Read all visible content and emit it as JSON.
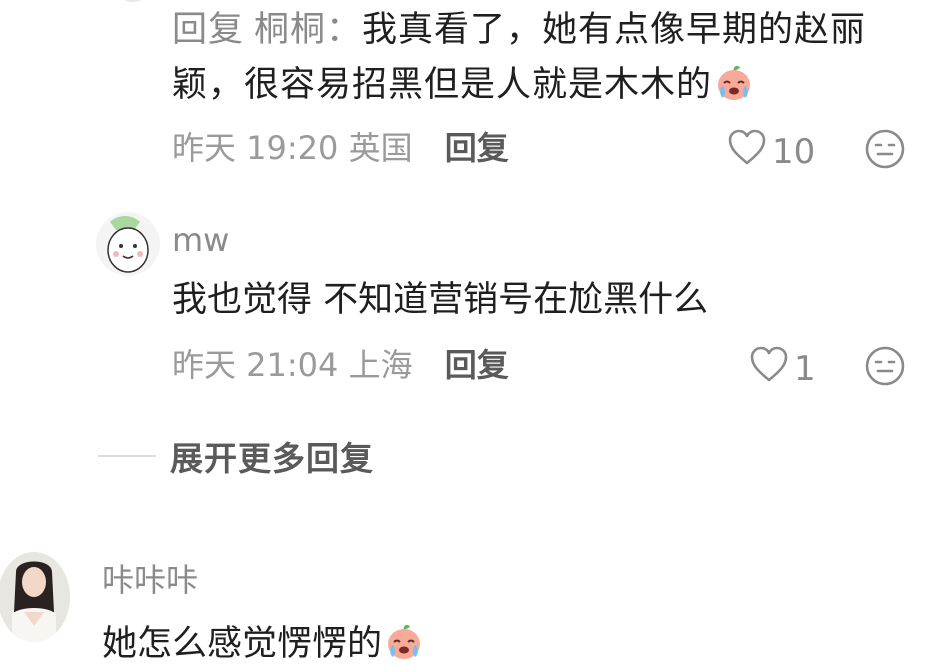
{
  "reply1": {
    "prefix": "回复",
    "to_user": "桐桐：",
    "text": "我真看了，她有点像早期的赵丽颖，很容易招黑但是人就是木木的",
    "emoji": "crying-laughing-peach-emoji",
    "time": "昨天 19:20",
    "location": "英国",
    "reply_label": "回复",
    "likes": "10"
  },
  "reply2": {
    "username": "mw",
    "text": "我也觉得 不知道营销号在尬黑什么",
    "time": "昨天 21:04",
    "location": "上海",
    "reply_label": "回复",
    "likes": "1"
  },
  "expand_label": "展开更多回复",
  "comment3": {
    "username": "咔咔咔",
    "text": "她怎么感觉愣愣的",
    "emoji": "crying-laughing-peach-emoji"
  },
  "icons": {
    "like": "heart-outline-icon",
    "react": "neutral-face-icon"
  },
  "colors": {
    "text_primary": "#1f1f1f",
    "text_secondary": "#8a8a8a",
    "text_meta": "#9a9a9a",
    "reply_button": "#5a5a5a"
  }
}
